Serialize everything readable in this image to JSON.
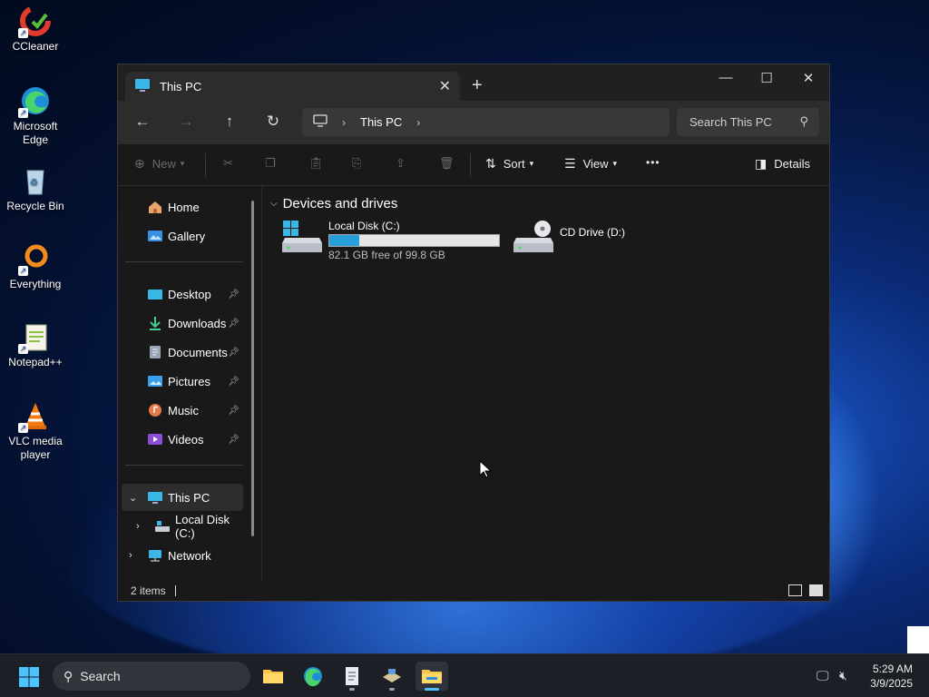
{
  "desktop": {
    "icons": [
      {
        "label": "CCleaner",
        "icon": "ccleaner-icon"
      },
      {
        "label": "Microsoft Edge",
        "icon": "edge-icon"
      },
      {
        "label": "Recycle Bin",
        "icon": "recycle-bin-icon"
      },
      {
        "label": "Everything",
        "icon": "everything-icon"
      },
      {
        "label": "Notepad++",
        "icon": "notepad-plus-plus-icon"
      },
      {
        "label": "VLC media player",
        "icon": "vlc-icon"
      }
    ]
  },
  "window": {
    "tab_title": "This PC",
    "tab_close": "✕",
    "new_tab": "+",
    "controls": {
      "minimize": "—",
      "maximize": "☐",
      "close": "✕"
    },
    "nav": {
      "back": "←",
      "forward": "→",
      "up": "↑",
      "refresh": "↻"
    },
    "address": {
      "crumb": "This PC",
      "separator": "›"
    },
    "search_placeholder": "Search This PC",
    "commands": {
      "new": "New",
      "sort": "Sort",
      "view": "View",
      "more": "•••",
      "details": "Details"
    },
    "sidebar": {
      "top": [
        {
          "label": "Home",
          "icon": "home-icon"
        },
        {
          "label": "Gallery",
          "icon": "gallery-icon"
        }
      ],
      "pinned": [
        {
          "label": "Desktop",
          "icon": "desktop-folder-icon"
        },
        {
          "label": "Downloads",
          "icon": "downloads-icon"
        },
        {
          "label": "Documents",
          "icon": "documents-icon"
        },
        {
          "label": "Pictures",
          "icon": "pictures-icon"
        },
        {
          "label": "Music",
          "icon": "music-icon"
        },
        {
          "label": "Videos",
          "icon": "videos-icon"
        }
      ],
      "this_pc": "This PC",
      "local_disk": "Local Disk (C:)",
      "network": "Network"
    },
    "content": {
      "group_title": "Devices and drives",
      "drives": [
        {
          "name": "Local Disk (C:)",
          "free_text": "82.1 GB free of 99.8 GB",
          "used_fraction": 0.177,
          "icon": "hard-drive-icon"
        },
        {
          "name": "CD Drive (D:)",
          "icon": "cd-drive-icon"
        }
      ]
    },
    "status": {
      "items": "2 items"
    }
  },
  "taskbar": {
    "search_label": "Search",
    "apps": [
      "file-explorer-folder-icon",
      "edge-icon",
      "notepad-icon",
      "installer-icon",
      "file-explorer-icon"
    ],
    "time": "5:29 AM",
    "date": "3/9/2025"
  },
  "colors": {
    "accent": "#26a0da",
    "window_bg": "#191919",
    "taskbar_bg": "#1c1f26"
  }
}
